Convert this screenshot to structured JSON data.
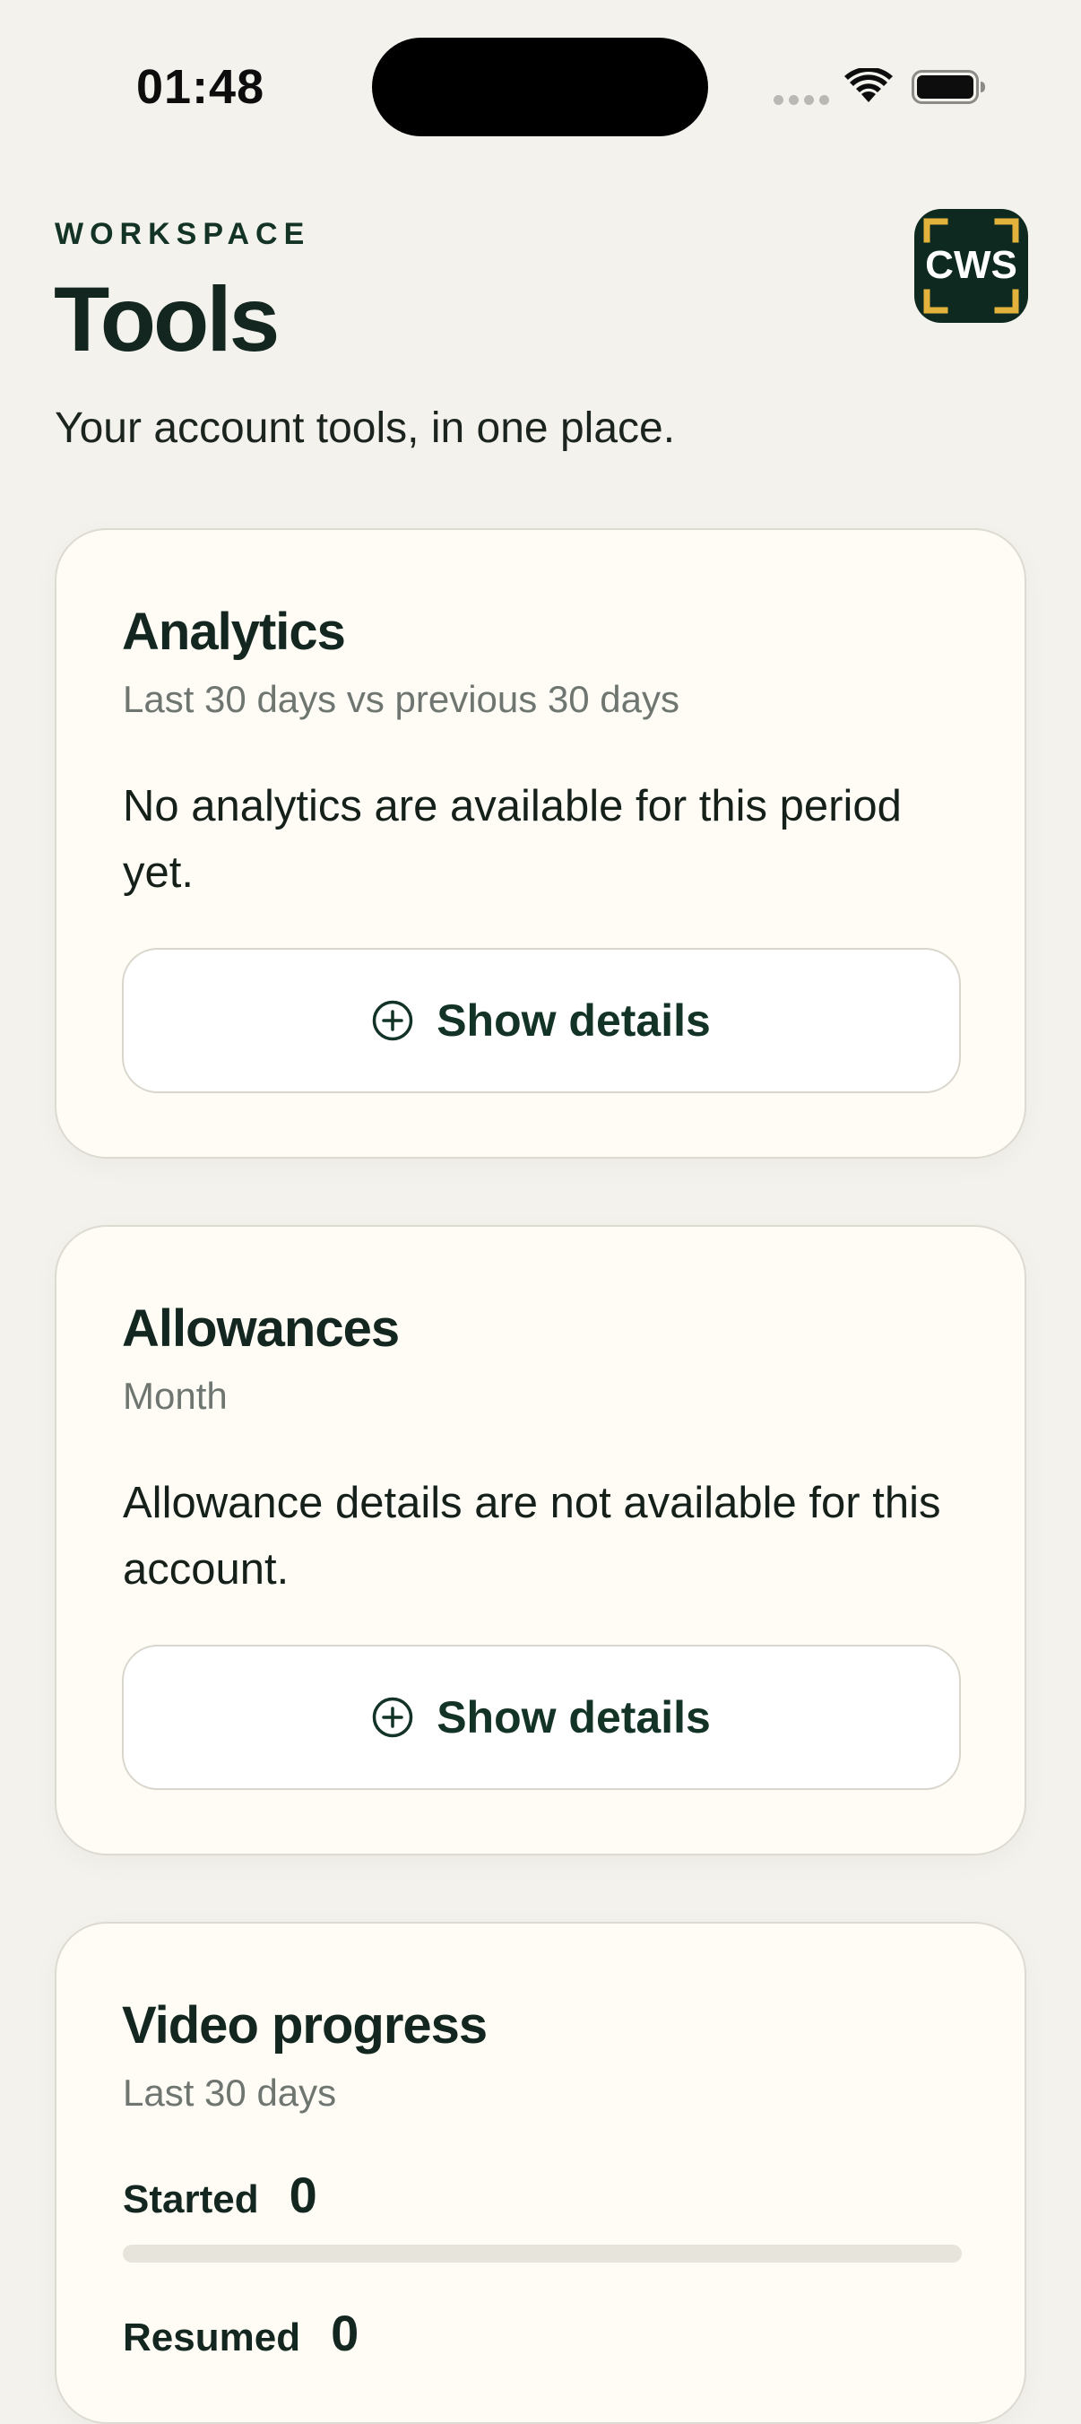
{
  "status_bar": {
    "time": "01:48"
  },
  "header": {
    "eyebrow": "WORKSPACE",
    "title": "Tools",
    "subtitle": "Your account tools, in one place.",
    "logo_text": "CWS"
  },
  "cards": {
    "analytics": {
      "title": "Analytics",
      "subtitle": "Last 30 days vs previous 30 days",
      "body": "No analytics are available for this period yet.",
      "button_label": "Show details",
      "button_icon": "plus-circle-icon"
    },
    "allowances": {
      "title": "Allowances",
      "subtitle": "Month",
      "body": "Allowance details are not available for this account.",
      "button_label": "Show details",
      "button_icon": "plus-circle-icon"
    },
    "video_progress": {
      "title": "Video progress",
      "subtitle": "Last 30 days",
      "started_label": "Started",
      "started_value": "0",
      "started_progress": 0,
      "resumed_label": "Resumed",
      "resumed_value": "0"
    }
  },
  "colors": {
    "background": "#f4f2ec",
    "card": "#fefcf5",
    "primary_dark": "#0e2a20",
    "logo_accent": "#e3b23c",
    "muted_text": "#6f7671"
  }
}
